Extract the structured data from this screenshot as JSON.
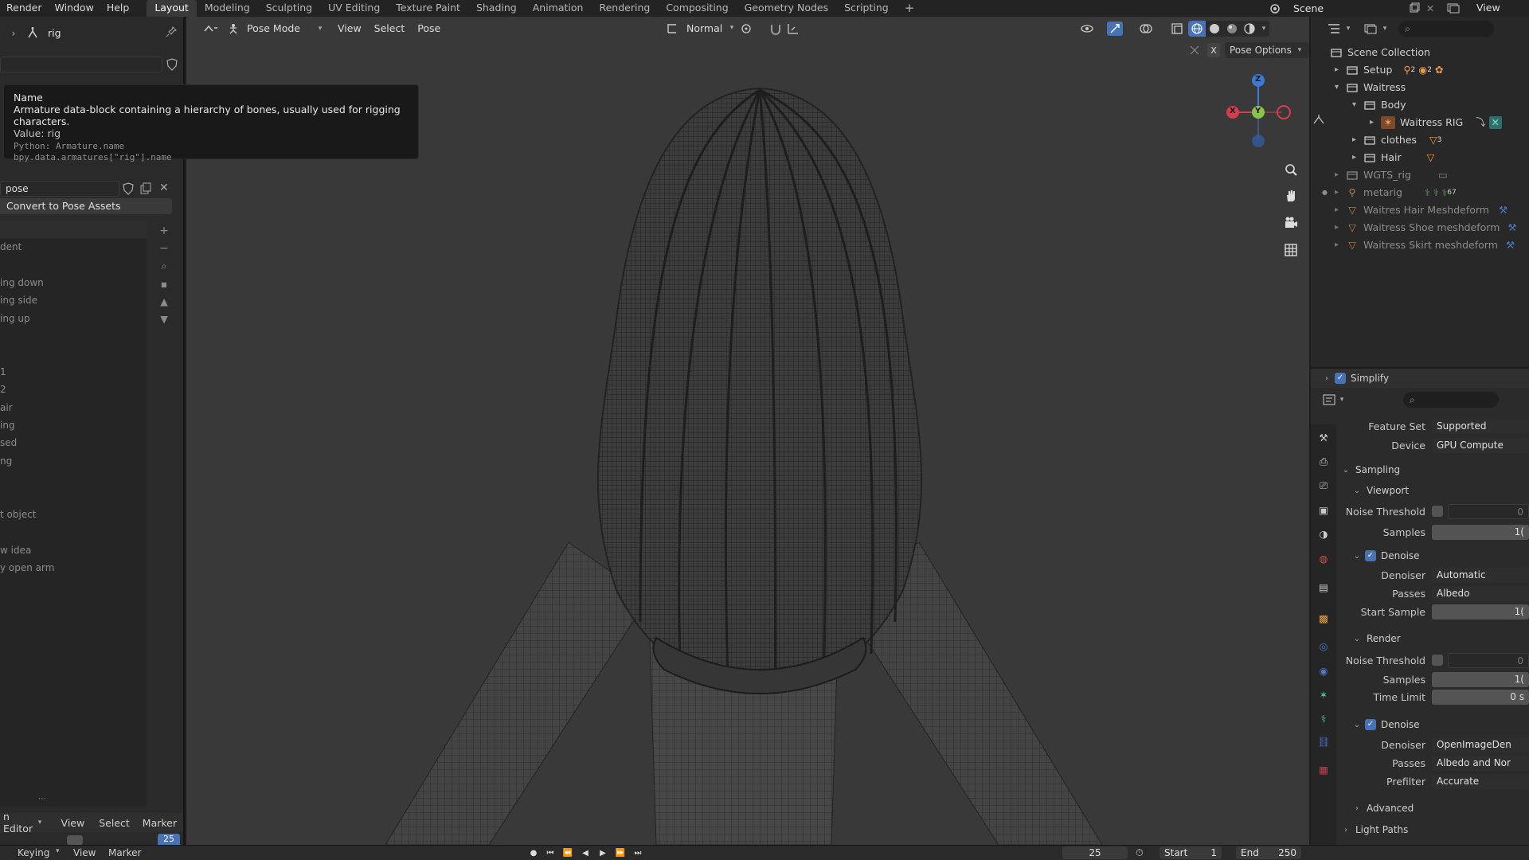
{
  "topbar": {
    "menus": [
      "Render",
      "Window",
      "Help"
    ],
    "workspaces": [
      "Layout",
      "Modeling",
      "Sculpting",
      "UV Editing",
      "Texture Paint",
      "Shading",
      "Animation",
      "Rendering",
      "Compositing",
      "Geometry Nodes",
      "Scripting"
    ],
    "active_workspace": "Layout",
    "add_tab": "+",
    "scene": "Scene",
    "view_layer": "View Layer"
  },
  "left": {
    "object_name": "rig",
    "tooltip": {
      "title": "Name",
      "description": "Armature data-block containing a hierarchy of bones, usually used for rigging characters.",
      "value": "Value: rig",
      "python1": "Python: Armature.name",
      "python2": "bpy.data.armatures[\"rig\"].name"
    },
    "pose_field": "pose",
    "convert_button": "Convert to Pose Assets",
    "list_items": [
      "dent",
      "",
      "ing down",
      "ing side",
      "ing up",
      "",
      "",
      "1",
      "2",
      "air",
      "ing",
      "sed",
      "ng",
      "",
      "",
      "t object",
      "",
      "w idea",
      "y open arm"
    ],
    "editor_menu": [
      "n Editor",
      "View",
      "Select",
      "Marker"
    ],
    "frame_value": "25"
  },
  "viewport": {
    "mode": "Pose Mode",
    "menus": [
      "View",
      "Select",
      "Pose"
    ],
    "orientation": "Normal",
    "pose_options": "Pose Options",
    "x_label": "X",
    "gizmo": {
      "x": "X",
      "y": "Y",
      "z": "Z"
    }
  },
  "outliner": {
    "items": [
      {
        "label": "Scene Collection",
        "level": 0,
        "arrow": "",
        "dim": false
      },
      {
        "label": "Setup",
        "level": 1,
        "arrow": "▸",
        "dim": false
      },
      {
        "label": "Waitress",
        "level": 1,
        "arrow": "▾",
        "dim": false
      },
      {
        "label": "Body",
        "level": 2,
        "arrow": "▾",
        "dim": false
      },
      {
        "label": "Waitress RIG",
        "level": 3,
        "arrow": "▸",
        "dim": false
      },
      {
        "label": "clothes",
        "level": 2,
        "arrow": "▸",
        "dim": false
      },
      {
        "label": "Hair",
        "level": 2,
        "arrow": "▸",
        "dim": false
      },
      {
        "label": "WGTS_rig",
        "level": 1,
        "arrow": "▸",
        "dim": true
      },
      {
        "label": "metarig",
        "level": 1,
        "arrow": "▸",
        "dim": true
      },
      {
        "label": "Waitres Hair Meshdeform",
        "level": 1,
        "arrow": "▸",
        "dim": true
      },
      {
        "label": "Waitress Shoe meshdeform",
        "level": 1,
        "arrow": "▸",
        "dim": true
      },
      {
        "label": "Waitress Skirt meshdeform",
        "level": 1,
        "arrow": "▸",
        "dim": true
      }
    ],
    "badges": {
      "setup_a": "2",
      "setup_b": "2",
      "clothes": "3",
      "metarig": "67"
    }
  },
  "properties": {
    "simplify": "Simplify",
    "feature_set_label": "Feature Set",
    "feature_set": "Supported",
    "device_label": "Device",
    "device": "GPU Compute",
    "sampling": "Sampling",
    "viewport": "Viewport",
    "noise_threshold": "Noise Threshold",
    "noise_value": "0",
    "samples": "Samples",
    "samples_value": "1(",
    "denoise": "Denoise",
    "denoiser_label": "Denoiser",
    "denoiser_vp": "Automatic",
    "passes_label": "Passes",
    "passes_vp": "Albedo",
    "start_sample": "Start Sample",
    "start_sample_value": "1(",
    "render": "Render",
    "render_noise_value": "0",
    "render_samples_value": "1(",
    "time_limit": "Time Limit",
    "time_limit_value": "0 s",
    "denoiser_render": "OpenImageDen",
    "passes_render": "Albedo and Nor",
    "prefilter_label": "Prefilter",
    "prefilter": "Accurate",
    "advanced": "Advanced",
    "light_paths": "Light Paths"
  },
  "bottom": {
    "keying": "Keying",
    "view": "View",
    "marker": "Marker",
    "current_frame": "25",
    "start_label": "Start",
    "start_value": "1",
    "end_label": "End",
    "end_value": "250"
  }
}
